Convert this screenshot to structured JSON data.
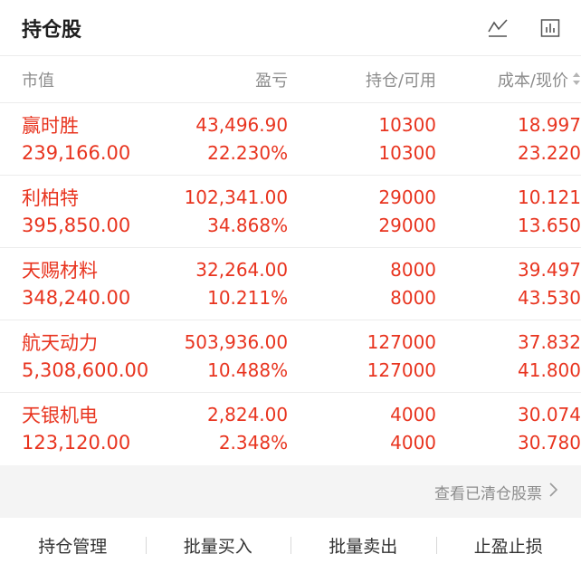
{
  "header": {
    "title": "持仓股",
    "icons": [
      "line-chart-icon",
      "bar-chart-icon"
    ]
  },
  "columns": {
    "market_value": "市值",
    "pnl": "盈亏",
    "position": "持仓/可用",
    "cost": "成本/现价"
  },
  "rows": [
    {
      "name": "赢时胜",
      "market_value": "239,166.00",
      "pnl": "43,496.90",
      "pnl_pct": "22.230%",
      "hold": "10300",
      "avail": "10300",
      "cost": "18.997",
      "price": "23.220"
    },
    {
      "name": "利柏特",
      "market_value": "395,850.00",
      "pnl": "102,341.00",
      "pnl_pct": "34.868%",
      "hold": "29000",
      "avail": "29000",
      "cost": "10.121",
      "price": "13.650"
    },
    {
      "name": "天赐材料",
      "market_value": "348,240.00",
      "pnl": "32,264.00",
      "pnl_pct": "10.211%",
      "hold": "8000",
      "avail": "8000",
      "cost": "39.497",
      "price": "43.530"
    },
    {
      "name": "航天动力",
      "market_value": "5,308,600.00",
      "pnl": "503,936.00",
      "pnl_pct": "10.488%",
      "hold": "127000",
      "avail": "127000",
      "cost": "37.832",
      "price": "41.800"
    },
    {
      "name": "天银机电",
      "market_value": "123,120.00",
      "pnl": "2,824.00",
      "pnl_pct": "2.348%",
      "hold": "4000",
      "avail": "4000",
      "cost": "30.074",
      "price": "30.780"
    }
  ],
  "cleared_link": "查看已清仓股票",
  "actions": [
    "持仓管理",
    "批量买入",
    "批量卖出",
    "止盈止损"
  ],
  "colors": {
    "profit": "#e8341f",
    "muted": "#8c8c8c"
  }
}
